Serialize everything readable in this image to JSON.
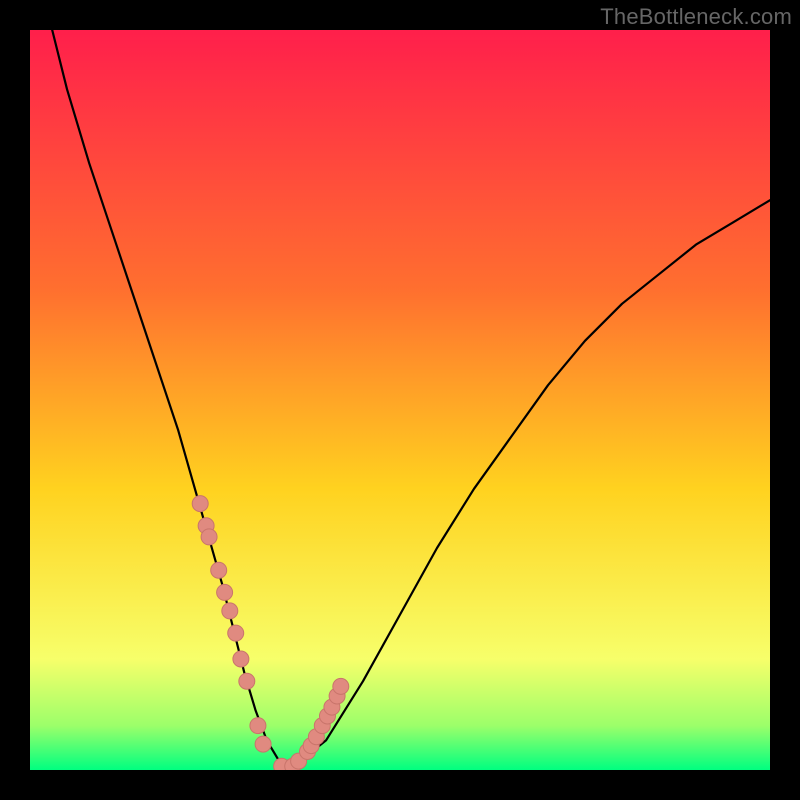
{
  "watermark": "TheBottleneck.com",
  "colors": {
    "frame": "#000000",
    "gradient_top": "#ff1f4b",
    "gradient_mid1": "#ff6f2f",
    "gradient_mid2": "#ffd21f",
    "gradient_mid3": "#f7ff6a",
    "gradient_bottom_band": "#9cff6a",
    "gradient_bottom": "#00ff80",
    "curve": "#000000",
    "marker_fill": "#e08a80",
    "marker_stroke": "#c9756b"
  },
  "chart_data": {
    "type": "line",
    "title": "",
    "xlabel": "",
    "ylabel": "",
    "xlim": [
      0,
      100
    ],
    "ylim": [
      0,
      100
    ],
    "grid": false,
    "legend": false,
    "series": [
      {
        "name": "bottleneck-curve",
        "x": [
          3,
          5,
          8,
          11,
          14,
          17,
          20,
          22,
          24,
          26,
          27.5,
          29,
          30.5,
          32,
          33.5,
          35,
          40,
          45,
          50,
          55,
          60,
          65,
          70,
          75,
          80,
          85,
          90,
          95,
          100
        ],
        "y": [
          100,
          92,
          82,
          73,
          64,
          55,
          46,
          39,
          32,
          25,
          19,
          13,
          8,
          4,
          1.5,
          0,
          4,
          12,
          21,
          30,
          38,
          45,
          52,
          58,
          63,
          67,
          71,
          74,
          77
        ]
      }
    ],
    "markers": {
      "name": "highlighted-points",
      "x": [
        23.0,
        23.8,
        24.2,
        25.5,
        26.3,
        27.0,
        27.8,
        28.5,
        29.3,
        30.8,
        31.5,
        34.0,
        35.5,
        36.3,
        37.5,
        38.0,
        38.7,
        39.5,
        40.2,
        40.8,
        41.5,
        42.0
      ],
      "y": [
        36,
        33,
        31.5,
        27,
        24,
        21.5,
        18.5,
        15,
        12,
        6,
        3.5,
        0.5,
        0.5,
        1.2,
        2.5,
        3.3,
        4.5,
        6.0,
        7.3,
        8.5,
        10.0,
        11.3
      ]
    }
  }
}
